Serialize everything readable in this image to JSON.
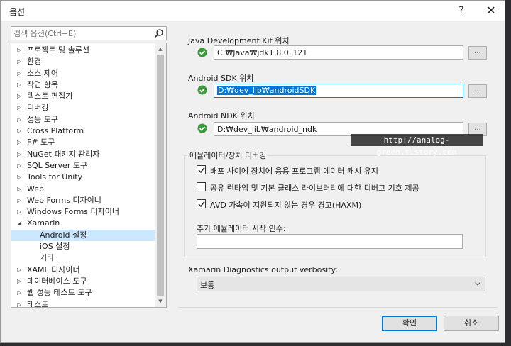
{
  "window": {
    "title": "옵션",
    "help_label": "?",
    "close_label": "✕"
  },
  "search": {
    "placeholder": "검색 옵션(Ctrl+E)"
  },
  "tree": {
    "items": [
      {
        "label": "프로젝트 및 솔루션",
        "expanded": false,
        "level": 0
      },
      {
        "label": "환경",
        "expanded": false,
        "level": 0
      },
      {
        "label": "소스 제어",
        "expanded": false,
        "level": 0
      },
      {
        "label": "작업 항목",
        "expanded": false,
        "level": 0
      },
      {
        "label": "텍스트 편집기",
        "expanded": false,
        "level": 0
      },
      {
        "label": "디버깅",
        "expanded": false,
        "level": 0
      },
      {
        "label": "성능 도구",
        "expanded": false,
        "level": 0
      },
      {
        "label": "Cross Platform",
        "expanded": false,
        "level": 0
      },
      {
        "label": "F# 도구",
        "expanded": false,
        "level": 0
      },
      {
        "label": "NuGet 패키지 관리자",
        "expanded": false,
        "level": 0
      },
      {
        "label": "SQL Server 도구",
        "expanded": false,
        "level": 0
      },
      {
        "label": "Tools for Unity",
        "expanded": false,
        "level": 0
      },
      {
        "label": "Web",
        "expanded": false,
        "level": 0
      },
      {
        "label": "Web Forms 디자이너",
        "expanded": false,
        "level": 0
      },
      {
        "label": "Windows Forms 디자이너",
        "expanded": false,
        "level": 0
      },
      {
        "label": "Xamarin",
        "expanded": true,
        "level": 0
      },
      {
        "label": "Android 설정",
        "level": 1,
        "selected": true
      },
      {
        "label": "iOS 설정",
        "level": 1
      },
      {
        "label": "기타",
        "level": 1
      },
      {
        "label": "XAML 디자이너",
        "expanded": false,
        "level": 0
      },
      {
        "label": "데이터베이스 도구",
        "expanded": false,
        "level": 0
      },
      {
        "label": "웹 성능 테스트 도구",
        "expanded": false,
        "level": 0
      },
      {
        "label": "테스트",
        "expanded": false,
        "level": 0
      }
    ]
  },
  "java": {
    "label": "Java Development Kit 위치",
    "path": "C:₩Java₩jdk1.8.0_121",
    "browse_label": "..."
  },
  "sdk": {
    "label": "Android SDK 위치",
    "path": "D:₩dev_lib₩androidSDK",
    "browse_label": "..."
  },
  "ndk": {
    "label": "Android NDK 위치",
    "path": "D:₩dev_lib₩android_ndk",
    "browse_label": "..."
  },
  "emulator": {
    "group_title": "에뮬레이터/장치 디버깅",
    "options": [
      {
        "label": "배포 사이에 장치에 응용 프로그램 데이터 캐시 유지",
        "checked": true
      },
      {
        "label": "공유 런타임 및 기본 클래스 라이브러리에 대한 디버그 기호 제공",
        "checked": false
      },
      {
        "label": "AVD 가속이 지원되지 않는 경우 경고(HAXM)",
        "checked": true
      }
    ],
    "args_label": "추가 에뮬레이터 시작 인수:",
    "args_value": ""
  },
  "diagnostics": {
    "label": "Xamarin Diagnostics output verbosity:",
    "value": "보통"
  },
  "buttons": {
    "ok_label": "확인",
    "cancel_label": "취소"
  },
  "watermark": "http://analog-green.tistory.com",
  "colors": {
    "accent": "#0078d7",
    "ok_green": "#3c9a3c",
    "selection": "#cce8ff"
  }
}
